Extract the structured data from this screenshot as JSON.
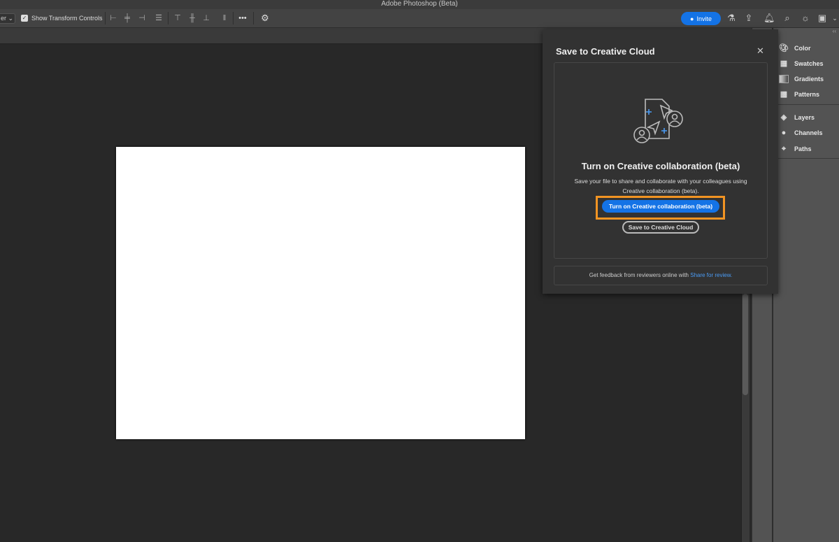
{
  "app": {
    "title": "Adobe Photoshop (Beta)"
  },
  "options_bar": {
    "tool_dropdown": "er",
    "show_transform_controls": "Show Transform Controls",
    "transform_checked": true,
    "more": "•••"
  },
  "top_right": {
    "invite": "Invite"
  },
  "right_panel": {
    "group1": [
      "Color",
      "Swatches",
      "Gradients",
      "Patterns"
    ],
    "group2": [
      "Layers",
      "Channels",
      "Paths"
    ]
  },
  "dialog": {
    "title": "Save to Creative Cloud",
    "close": "✕",
    "heading": "Turn on Creative collaboration (beta)",
    "body": "Save your file to share and collaborate with your colleagues using Creative collaboration (beta).",
    "primary_button": "Turn on Creative collaboration (beta)",
    "secondary_button": "Save to Creative Cloud",
    "footer_text": "Get feedback from reviewers online with ",
    "footer_link": "Share for review.",
    "highlight_color": "#f29423",
    "accent_color": "#1473e6"
  }
}
